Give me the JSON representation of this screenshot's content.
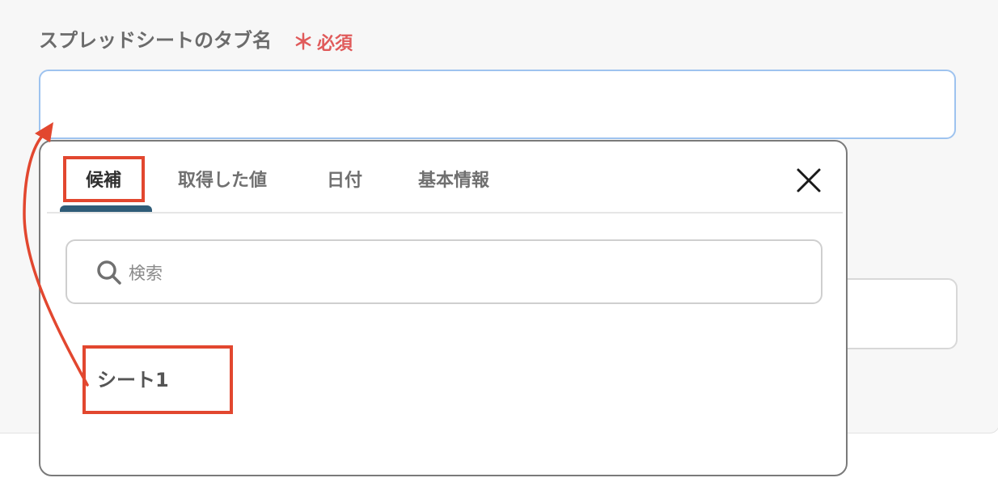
{
  "form": {
    "field_label": "スプレッドシートのタブ名",
    "required_star": "＊",
    "required_label": "必須",
    "tab_name_value": ""
  },
  "popup": {
    "tabs": [
      {
        "label": "候補",
        "active": true
      },
      {
        "label": "取得した値",
        "active": false
      },
      {
        "label": "日付",
        "active": false
      },
      {
        "label": "基本情報",
        "active": false
      }
    ],
    "search_placeholder": "検索",
    "options": [
      {
        "label": "シート1"
      }
    ]
  },
  "annotation_color": "#e2472f",
  "accent_color": "#2f5c78",
  "icons": {
    "close": "close-icon",
    "search": "search-icon"
  }
}
